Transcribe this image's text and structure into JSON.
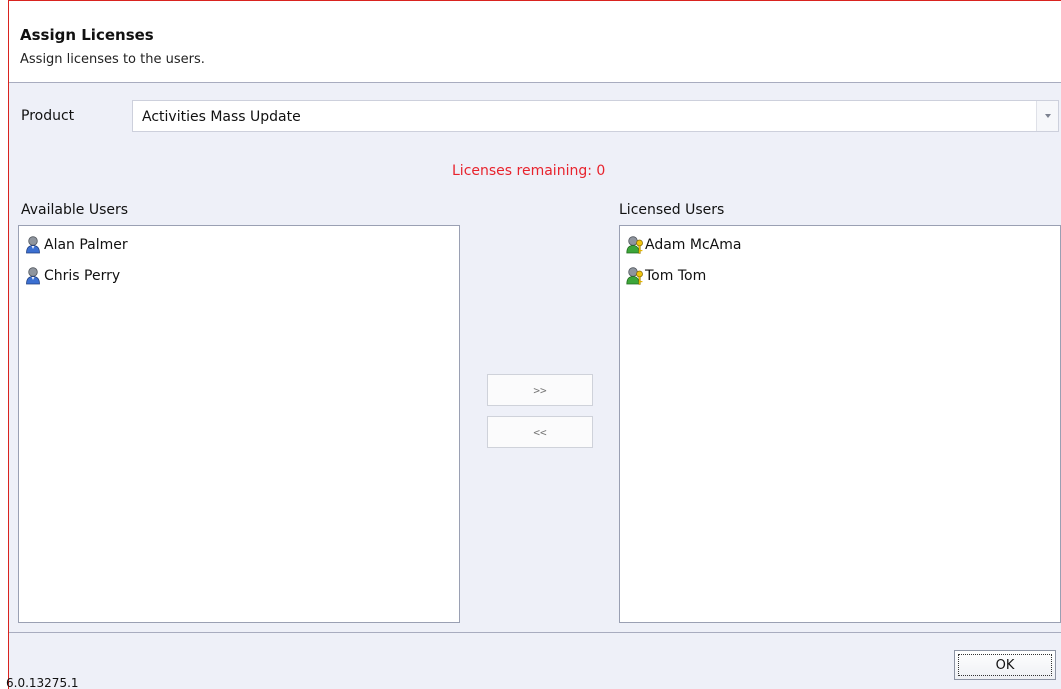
{
  "header": {
    "title": "Assign Licenses",
    "subtitle": "Assign licenses to the users."
  },
  "product": {
    "label": "Product",
    "selected": "Activities Mass Update"
  },
  "licenses_remaining": "Licenses remaining: 0",
  "available_users": {
    "label": "Available Users",
    "items": [
      {
        "name": "Alan Palmer",
        "icon": "user-icon"
      },
      {
        "name": "Chris Perry",
        "icon": "user-icon"
      }
    ]
  },
  "licensed_users": {
    "label": "Licensed Users",
    "items": [
      {
        "name": "Adam McAma",
        "icon": "licensed-user-icon"
      },
      {
        "name": "Tom Tom",
        "icon": "licensed-user-icon"
      }
    ]
  },
  "buttons": {
    "add": ">>",
    "remove": "<<",
    "ok": "OK"
  },
  "version": "6.0.13275.1",
  "colors": {
    "accent_border": "#d9231f",
    "remaining_text": "#e8232d",
    "panel_background": "#eef0f8"
  }
}
